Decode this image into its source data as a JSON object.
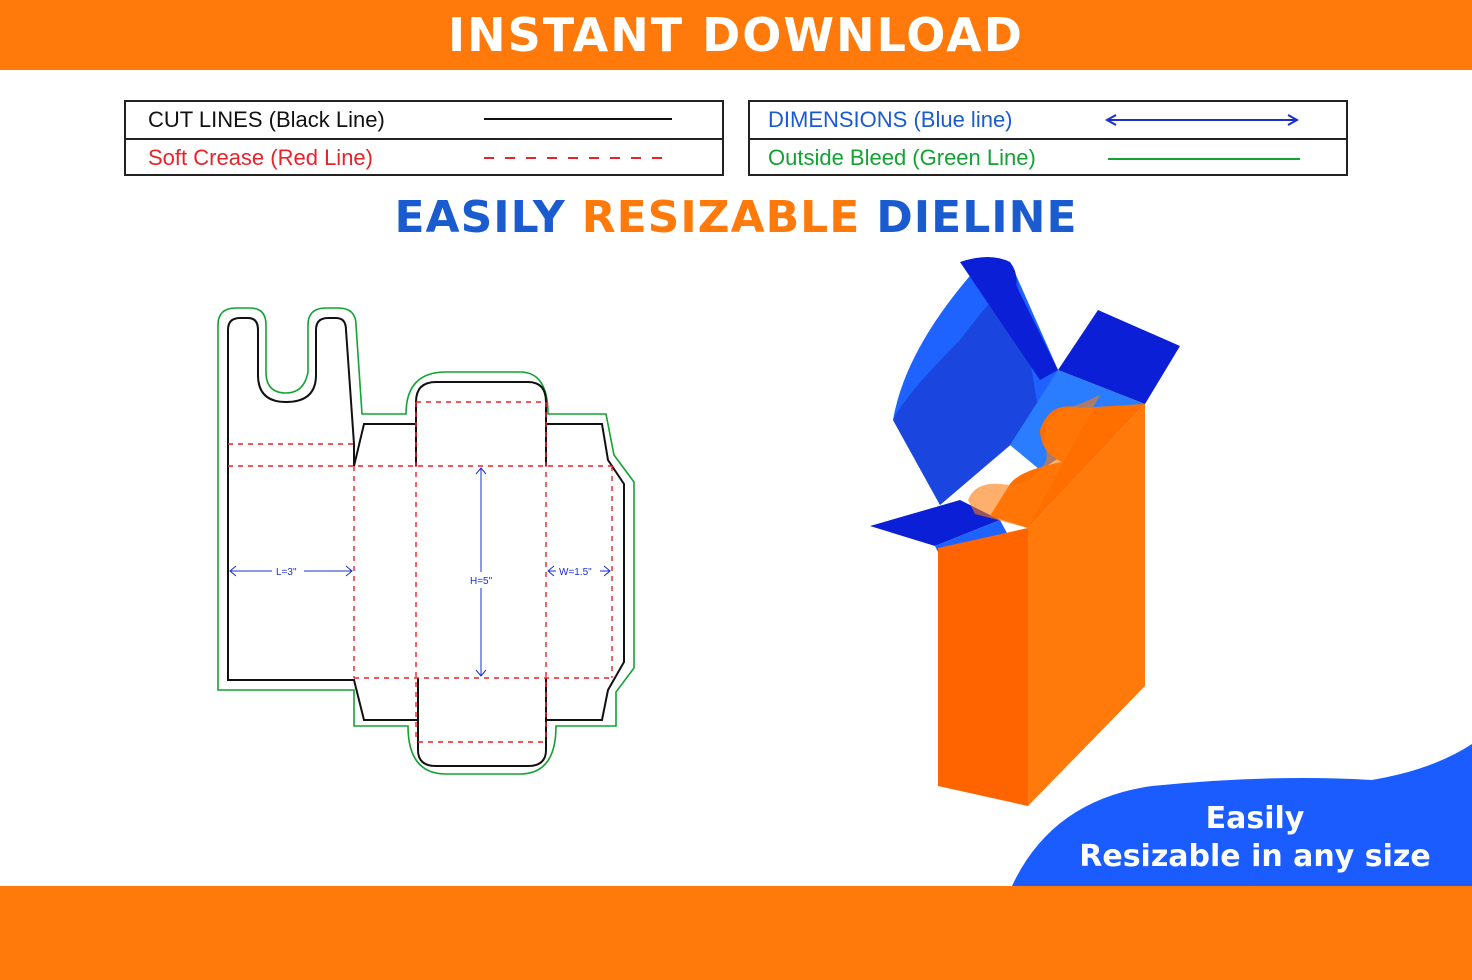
{
  "banner": {
    "title": "INSTANT DOWNLOAD"
  },
  "legend": {
    "cut_lines": "CUT LINES (Black Line)",
    "soft_crease": "Soft Crease (Red Line)",
    "dimensions": "DIMENSIONS (Blue line)",
    "outside_bleed": "Outside Bleed (Green Line)"
  },
  "headline": {
    "word1": "EASILY",
    "word2": "RESIZABLE",
    "word3": "DIELINE"
  },
  "dieline": {
    "length_label": "L=3\"",
    "height_label": "H=5\"",
    "width_label": "W=1.5\""
  },
  "corner": {
    "line1": "Easily",
    "line2": "Resizable in any size"
  },
  "colors": {
    "orange": "#ff7a0a",
    "blue": "#1a5cff",
    "cut_line": "#111111",
    "crease_line": "#e8232a",
    "dimension_line": "#1a2fd0",
    "bleed_line": "#12a332"
  }
}
